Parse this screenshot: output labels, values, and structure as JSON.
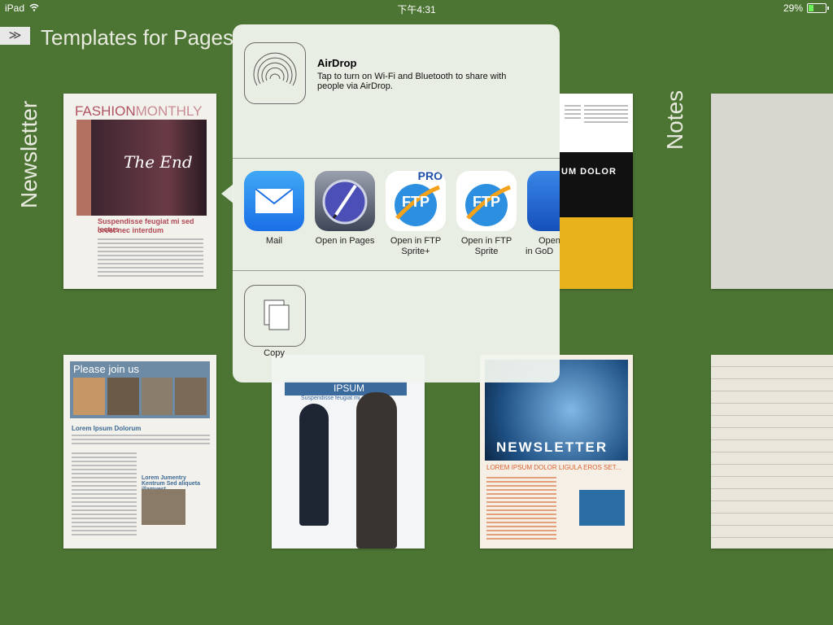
{
  "status_bar": {
    "device": "iPad",
    "time": "下午4:31",
    "battery": "29%",
    "battery_level": 0.29
  },
  "header": {
    "expand_label": "≫",
    "title": "Templates for Pages"
  },
  "sections": {
    "left": "Newsletter",
    "right": "Notes"
  },
  "thumbnails": {
    "fashion": {
      "title_a": "FASHION",
      "title_b": "MONTHLY",
      "cover_text": "The End",
      "headline": "Suspendisse feugiat mi sed lectus",
      "subhead": "oreet nec interdum"
    },
    "join": {
      "banner": "Please join us",
      "heading": "Lorem Ipsum Dolorum",
      "subhead": "Lorem Jumentry Kentrum Sed aliqueta illamvest"
    },
    "business": {
      "top": "IPSUM",
      "sub": "Suspendisse feugiat mi sed lectus"
    },
    "dolor": {
      "banner": "UM DOLOR"
    },
    "newsletter": {
      "title": "NEWSLETTER",
      "headline": "LOREM IPSUM DOLOR LIGULA EROS SET..."
    }
  },
  "share_sheet": {
    "airdrop_title": "AirDrop",
    "airdrop_desc": "Tap to turn on Wi-Fi and Bluetooth to share with people via AirDrop.",
    "apps": [
      {
        "label": "Mail",
        "icon": "mail-icon"
      },
      {
        "label": "Open in Pages",
        "icon": "pages-icon"
      },
      {
        "label": "Open in FTP Sprite+",
        "icon": "ftp-pro-icon"
      },
      {
        "label": "Open in FTP Sprite",
        "icon": "ftp-icon"
      },
      {
        "label": "Open in GoD",
        "icon": "godocs-icon"
      }
    ],
    "copy_label": "Copy"
  },
  "ftp_badge": {
    "text": "FTP",
    "pro": "PRO"
  }
}
